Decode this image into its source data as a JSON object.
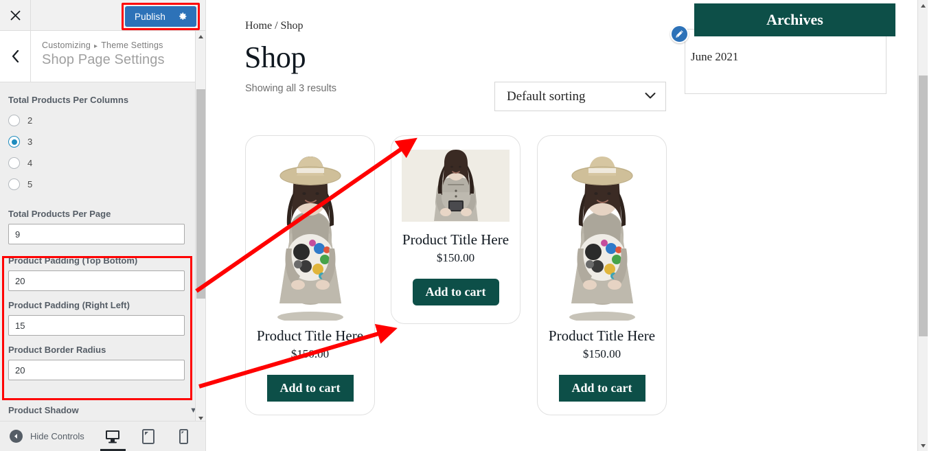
{
  "customizer": {
    "close_icon": "close-x-icon",
    "publish_label": "Publish",
    "publish_gear_icon": "gear-icon",
    "back_icon": "chevron-left-icon",
    "breadcrumb_root": "Customizing",
    "breadcrumb_sep": "▸",
    "breadcrumb_section": "Theme Settings",
    "panel_title": "Shop Page Settings",
    "accent_blue": "#2d72b8",
    "radio_accent": "#1e8cbe",
    "annotation_color": "#ff0000",
    "controls": {
      "columns_label": "Total Products Per Columns",
      "columns_options": [
        "2",
        "3",
        "4",
        "5"
      ],
      "columns_selected": "3",
      "per_page_label": "Total Products Per Page",
      "per_page_value": "9",
      "padding_tb_label": "Product Padding (Top Bottom)",
      "padding_tb_value": "20",
      "padding_rl_label": "Product Padding (Right Left)",
      "padding_rl_value": "15",
      "border_radius_label": "Product Border Radius",
      "border_radius_value": "20",
      "shadow_label": "Product Shadow"
    },
    "footer": {
      "hide_controls_label": "Hide Controls",
      "hide_icon": "caret-left-circle-icon",
      "devices": [
        {
          "name": "desktop",
          "icon": "desktop-icon",
          "active": true
        },
        {
          "name": "tablet",
          "icon": "tablet-icon",
          "active": false
        },
        {
          "name": "mobile",
          "icon": "mobile-icon",
          "active": false
        }
      ]
    }
  },
  "preview": {
    "breadcrumb": "Home / Shop",
    "page_title": "Shop",
    "results_count": "Showing all 3 results",
    "sort": {
      "selected": "Default sorting",
      "chevron_icon": "chevron-down-icon"
    },
    "products": [
      {
        "title": "Product Title Here",
        "price": "$150.00",
        "add_to_cart": "Add to cart",
        "image": "girl-with-hat-holding-colorful-ball",
        "image_bg": "#ffffff"
      },
      {
        "title": "Product Title Here",
        "price": "$150.00",
        "add_to_cart": "Add to cart",
        "image": "woman-with-phone",
        "image_bg": "#efece4"
      },
      {
        "title": "Product Title Here",
        "price": "$150.00",
        "add_to_cart": "Add to cart",
        "image": "girl-with-hat-holding-colorful-ball",
        "image_bg": "#ffffff"
      }
    ],
    "widget": {
      "title": "Archives",
      "items": [
        "June 2021"
      ],
      "header_bg": "#0d4f48",
      "edit_icon": "pencil-edit-icon"
    },
    "theme_accent": "#0d4f48"
  }
}
